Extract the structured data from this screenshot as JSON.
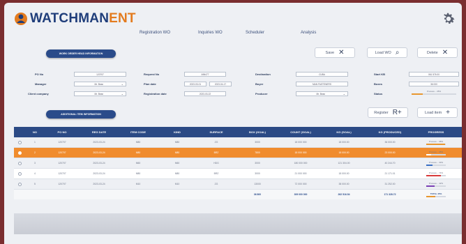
{
  "app": {
    "logo_part1": "WATCHMAN",
    "logo_part2": "ENT"
  },
  "nav": [
    {
      "label": "Registration WO",
      "x": 0
    },
    {
      "label": "Inquiries WO"
    },
    {
      "label": "Scheduler"
    },
    {
      "label": "Analysis"
    }
  ],
  "sections": {
    "head": "WORK ORDER HEAD INFORMATION",
    "items": "ADDITIONAL ITEM INFORMATION"
  },
  "actions": {
    "save": "Save",
    "load_wo": "Load WO",
    "delete": "Delete",
    "register": "Register",
    "load_item": "Load item"
  },
  "form": {
    "po_no_label": "PO No",
    "po_no": "120707",
    "request_no_label": "Request No",
    "request_no": "A96477",
    "destination_label": "Destination",
    "destination": "CUBA",
    "start_kb_label": "Start KB",
    "start_kb": "061 576 00",
    "manager_label": "Manager",
    "manager": "Mr. Bean",
    "plan_date_label": "Plan date",
    "plan_date_from": "2023-03-01",
    "plan_date_to": "2023-04-17",
    "buyer_label": "Buyer",
    "buyer": "MAN FASTENERS",
    "boxes_label": "Boxes",
    "boxes": "36 000",
    "client_company_label": "Client company",
    "client_company": "Mr. Bean",
    "registration_date_label": "Registration date",
    "registration_date": "2023-03-22",
    "producer_label": "Producer",
    "producer": "Mr. Bean",
    "status_label": "Status",
    "status_text": "Process... 25%",
    "status_pct": 25
  },
  "table": {
    "headers": [
      "NO",
      "PO NO",
      "REG DATE",
      "ITEM CODE",
      "KIND",
      "SURFACE",
      "BOX (GOAL)",
      "COUNT (GOAL)",
      "KG (GOAL)",
      "KG (PRODUCED)",
      "PROGRESS"
    ],
    "rows": [
      {
        "no": "1",
        "po": "120707",
        "date": "2023-03-24",
        "code": "M80",
        "kind": "M80",
        "surface": "ZG",
        "box": "3000",
        "count": "18 000 000",
        "kg": "18 000.00",
        "kgp": "36 000.00",
        "prog": "Process... 98%",
        "pct": 98,
        "color": "#e8972f"
      },
      {
        "no": "2",
        "po": "120707",
        "date": "2023-03-24",
        "code": "M80",
        "kind": "M80",
        "surface": "BRZ",
        "box": "7800",
        "count": "18 000 000",
        "kg": "18 000.00",
        "kgp": "23 000.00",
        "prog": "Process... 25%",
        "pct": 25,
        "color": "#ffffff"
      },
      {
        "no": "3",
        "po": "120707",
        "date": "2023-03-24",
        "code": "M60",
        "kind": "M60",
        "surface": "HDG",
        "box": "3000",
        "count": "180 000 000",
        "kg": "121 304.00",
        "kgp": "40 244.70",
        "prog": "Process... 33%",
        "pct": 33,
        "color": "#3a6fc4"
      },
      {
        "no": "4",
        "po": "120707",
        "date": "2023-03-24",
        "code": "M80",
        "kind": "M80",
        "surface": "BRZ",
        "box": "3000",
        "count": "21 000 000",
        "kg": "18 000.00",
        "kgp": "21 171.01",
        "prog": "Process... 74%",
        "pct": 74,
        "color": "#d83a3a"
      },
      {
        "no": "5",
        "po": "120707",
        "date": "2023-03-24",
        "code": "M10",
        "kind": "M10",
        "surface": "ZG",
        "box": "13000",
        "count": "72 000 000",
        "kg": "38 000.00",
        "kgp": "31 252.00",
        "prog": "Process... 42%",
        "pct": 42,
        "color": "#7a3fb5"
      }
    ],
    "selected_row": 1,
    "totals": {
      "box": "36 800",
      "count": "309 000 000",
      "kg": "262 516.54",
      "kgp": "171 328.72",
      "prog": "TOTAL 45%",
      "pct": 45,
      "color": "#e8972f"
    }
  }
}
